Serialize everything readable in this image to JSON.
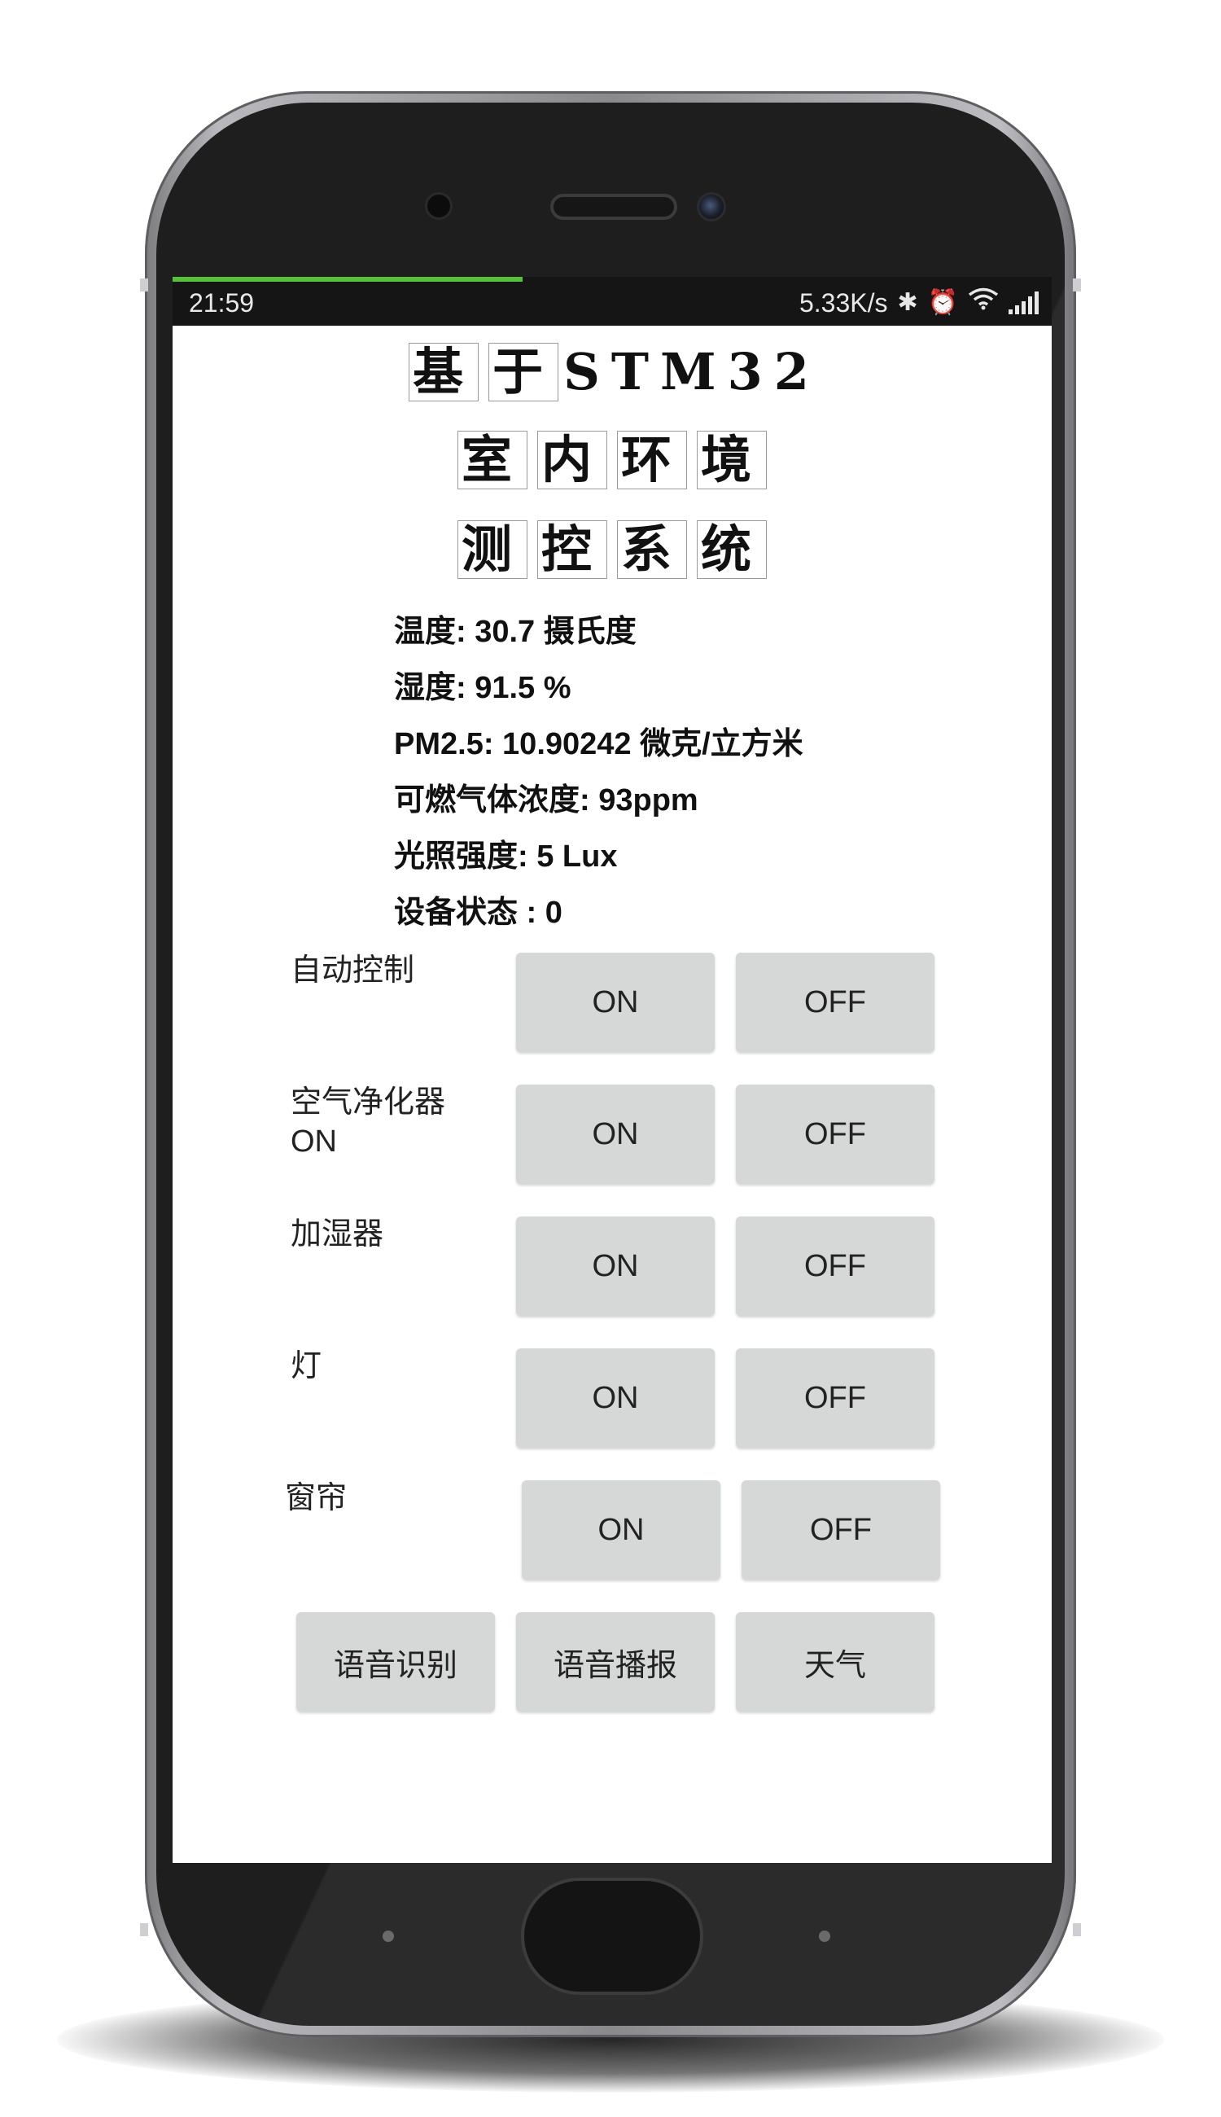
{
  "status_bar": {
    "time": "21:59",
    "net_speed": "5.33K/s",
    "icons": [
      "bluetooth-icon",
      "alarm-icon",
      "wifi-icon",
      "signal-icon"
    ]
  },
  "app": {
    "title_lines": [
      [
        "基",
        "于",
        "STM32"
      ],
      [
        "室",
        "内",
        "环",
        "境"
      ],
      [
        "测",
        "控",
        "系",
        "统"
      ]
    ],
    "readings": [
      {
        "label": "温度: ",
        "value": "30.7 摄氏度"
      },
      {
        "label": "湿度: ",
        "value": "91.5 %"
      },
      {
        "label": "PM2.5: ",
        "value": "10.90242 微克/立方米"
      },
      {
        "label": "可燃气体浓度: ",
        "value": "93ppm"
      },
      {
        "label": "光照强度: ",
        "value": "5 Lux"
      },
      {
        "label": "设备状态 : ",
        "value": "0"
      }
    ],
    "controls": [
      {
        "label": "自动控制",
        "status": "",
        "on": "ON",
        "off": "OFF"
      },
      {
        "label": "空气净化器",
        "status": "ON",
        "on": "ON",
        "off": "OFF"
      },
      {
        "label": "加湿器",
        "status": "",
        "on": "ON",
        "off": "OFF"
      },
      {
        "label": "灯",
        "status": "",
        "on": "ON",
        "off": "OFF"
      },
      {
        "label": "窗帘",
        "status": "",
        "on": "ON",
        "off": "OFF"
      }
    ],
    "bottom_buttons": [
      "语音识别",
      "语音播报",
      "天气"
    ]
  },
  "colors": {
    "progress": "#55c23a",
    "button_bg": "#d6d7d7",
    "status_bar_bg": "#151515",
    "phone_frame": "#1e1e1f"
  }
}
